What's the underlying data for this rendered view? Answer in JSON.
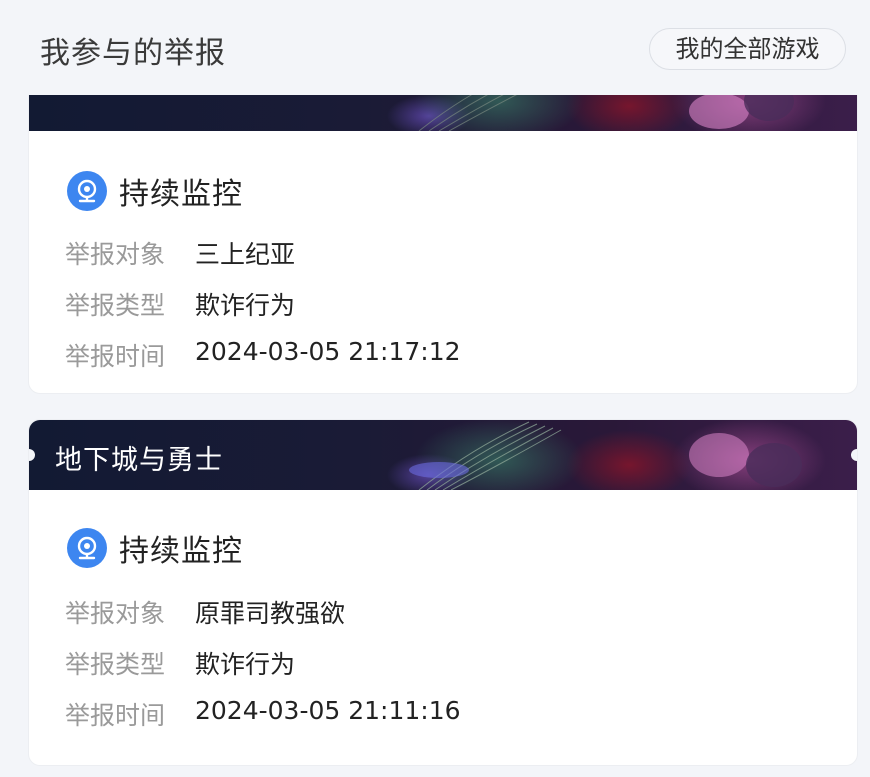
{
  "header": {
    "title": "我参与的举报",
    "all_games_label": "我的全部游戏"
  },
  "cards": [
    {
      "game": "",
      "status": "持续监控",
      "fields": [
        {
          "label": "举报对象",
          "value": "三上纪亚"
        },
        {
          "label": "举报类型",
          "value": "欺诈行为"
        },
        {
          "label": "举报时间",
          "value": "2024-03-05 21:17:12"
        }
      ]
    },
    {
      "game": "地下城与勇士",
      "status": "持续监控",
      "fields": [
        {
          "label": "举报对象",
          "value": "原罪司教强欲"
        },
        {
          "label": "举报类型",
          "value": "欺诈行为"
        },
        {
          "label": "举报时间",
          "value": "2024-03-05 21:11:16"
        }
      ]
    }
  ],
  "colors": {
    "accent": "#3d86f0",
    "page_bg": "#f3f5f9",
    "label_gray": "#9a9a9a"
  },
  "icons": {
    "status": "monitor-camera-icon"
  }
}
